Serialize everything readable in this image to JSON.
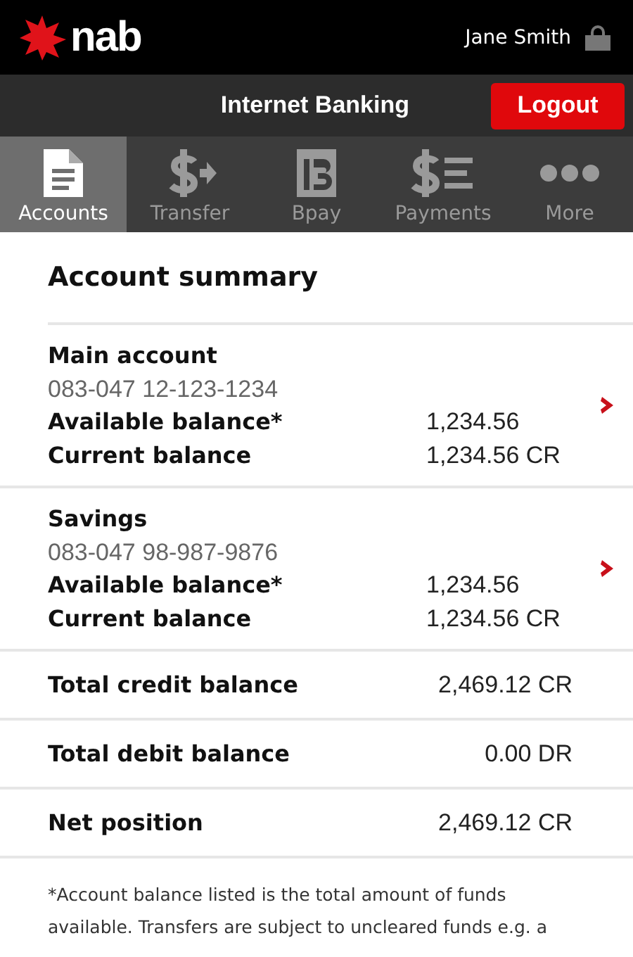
{
  "header": {
    "brand": "nab",
    "user": "Jane Smith"
  },
  "bar": {
    "title": "Internet Banking",
    "logout": "Logout"
  },
  "tabs": [
    {
      "label": "Accounts",
      "selected": true
    },
    {
      "label": "Transfer",
      "selected": false
    },
    {
      "label": "Bpay",
      "selected": false
    },
    {
      "label": "Payments",
      "selected": false
    },
    {
      "label": "More",
      "selected": false
    }
  ],
  "summary_title": "Account summary",
  "accounts": [
    {
      "name": "Main account",
      "number": "083-047 12-123-1234",
      "available_label": "Available balance*",
      "available": "1,234.56",
      "current_label": "Current balance",
      "current": "1,234.56 CR"
    },
    {
      "name": "Savings",
      "number": "083-047 98-987-9876",
      "available_label": "Available balance*",
      "available": "1,234.56",
      "current_label": "Current balance",
      "current": "1,234.56 CR"
    }
  ],
  "totals": [
    {
      "label": "Total credit balance",
      "value": "2,469.12 CR"
    },
    {
      "label": "Total debit balance",
      "value": "0.00 DR"
    },
    {
      "label": "Net position",
      "value": "2,469.12 CR"
    }
  ],
  "footnote": "*Account balance listed is the total amount of funds available. Transfers are subject to uncleared funds e.g. a"
}
